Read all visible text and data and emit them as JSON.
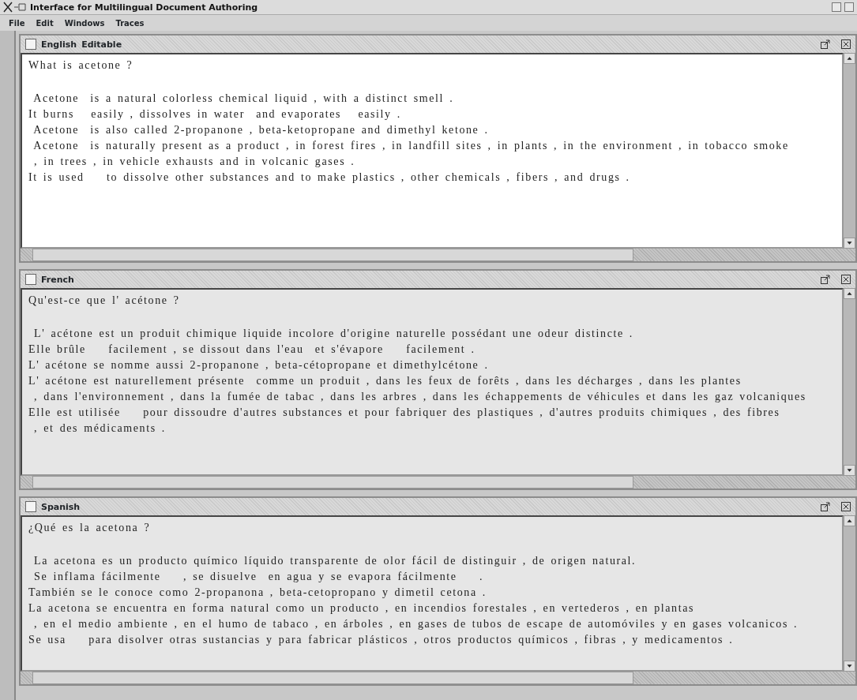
{
  "window": {
    "title": "Interface for Multilingual Document Authoring"
  },
  "menu": [
    "File",
    "Edit",
    "Windows",
    "Traces"
  ],
  "panels": [
    {
      "title": "English",
      "status_label": "Editable",
      "editable": true,
      "checked": false,
      "question": "What is acetone ?",
      "lines": [
        " Acetone  is a natural colorless chemical liquid , with a distinct smell .",
        "It burns   easily , dissolves in water  and evaporates   easily .",
        " Acetone  is also called 2-propanone , beta-ketopropane and dimethyl ketone .",
        " Acetone  is naturally present as a product , in forest fires , in landfill sites , in plants , in the environment , in tobacco smoke",
        " , in trees , in vehicle exhausts and in volcanic gases .",
        "It is used    to dissolve other substances and to make plastics , other chemicals , fibers , and drugs ."
      ]
    },
    {
      "title": "French",
      "editable": false,
      "checked": false,
      "question": "Qu'est-ce que l' acétone ?",
      "lines": [
        " L' acétone est un produit chimique liquide incolore d'origine naturelle possédant une odeur distincte .",
        "Elle brûle    facilement , se dissout dans l'eau  et s'évapore    facilement .",
        "L' acétone se nomme aussi 2-propanone , beta-cétopropane et dimethylcétone .",
        "L' acétone est naturellement présente  comme un produit , dans les feux de forêts , dans les décharges , dans les plantes",
        " , dans l'environnement , dans la fumée de tabac , dans les arbres , dans les échappements de véhicules et dans les gaz volcaniques",
        "Elle est utilisée    pour dissoudre d'autres substances et pour fabriquer des plastiques , d'autres produits chimiques , des fibres",
        " , et des médicaments ."
      ]
    },
    {
      "title": "Spanish",
      "editable": false,
      "checked": false,
      "question": "¿Qué es la acetona ?",
      "lines": [
        " La acetona es un producto químico líquido transparente de olor fácil de distinguir , de origen natural.",
        " Se inflama fácilmente    , se disuelve  en agua y se evapora fácilmente    .",
        "También se le conoce como 2-propanona , beta-cetopropano y dimetil cetona .",
        "La acetona se encuentra en forma natural como un producto , en incendios forestales , en vertederos , en plantas",
        " , en el medio ambiente , en el humo de tabaco , en árboles , en gases de tubos de escape de automóviles y en gases volcanicos .",
        "Se usa    para disolver otras sustancias y para fabricar plásticos , otros productos químicos , fibras , y medicamentos ."
      ]
    }
  ]
}
